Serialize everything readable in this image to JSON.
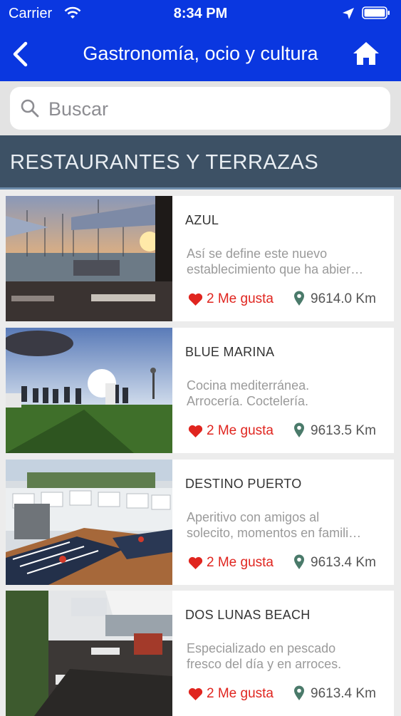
{
  "status_bar": {
    "carrier": "Carrier",
    "time": "8:34 PM"
  },
  "header": {
    "title": "Gastronomía, ocio y cultura",
    "back_icon": "chevron-left-icon",
    "home_icon": "home-icon"
  },
  "search": {
    "placeholder": "Buscar",
    "value": ""
  },
  "section": {
    "title": "RESTAURANTES Y TERRAZAS"
  },
  "colors": {
    "brand": "#0a37e0",
    "section_bg": "#3d5165",
    "like": "#e0251f",
    "pin": "#4a7a6a"
  },
  "items": [
    {
      "name": "AZUL",
      "desc_line1": "Así se define este nuevo",
      "desc_line2": "establecimiento que ha abier…",
      "likes": "2 Me gusta",
      "distance": "9614.0 Km"
    },
    {
      "name": "BLUE MARINA",
      "desc_line1": "Cocina mediterránea.",
      "desc_line2": "Arrocería. Coctelería.",
      "likes": "2 Me gusta",
      "distance": "9613.5 Km"
    },
    {
      "name": "DESTINO PUERTO",
      "desc_line1": "Aperitivo con amigos al",
      "desc_line2": "solecito, momentos en famili…",
      "likes": "2 Me gusta",
      "distance": "9613.4 Km"
    },
    {
      "name": "DOS LUNAS BEACH",
      "desc_line1": "Especializado en pescado",
      "desc_line2": "fresco del día y en arroces.",
      "likes": "2 Me gusta",
      "distance": "9613.4 Km"
    }
  ]
}
